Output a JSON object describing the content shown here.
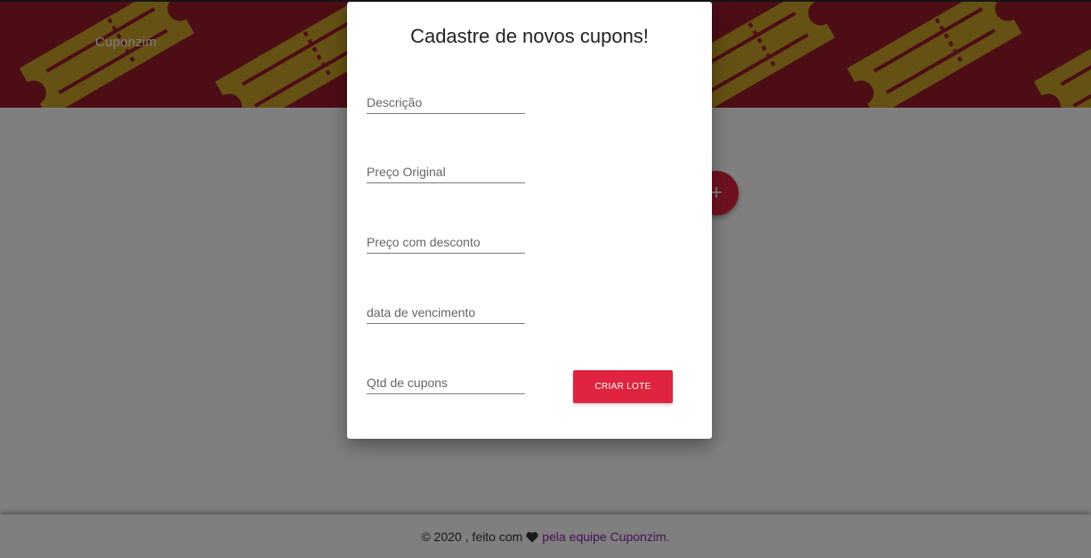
{
  "header": {
    "brand": "Cuponzim"
  },
  "fab": {
    "label": "+"
  },
  "modal": {
    "title": "Cadastre de novos cupons!",
    "fields": [
      {
        "placeholder": "Descrição"
      },
      {
        "placeholder": "Preço Original"
      },
      {
        "placeholder": "Preço com desconto"
      },
      {
        "placeholder": "data de vencimento"
      },
      {
        "placeholder": "Qtd de cupons"
      }
    ],
    "submit_label": "CRIAR LOTE"
  },
  "footer": {
    "prefix": "© 2020 , feito com",
    "link": "pela equipe Cuponzim."
  },
  "colors": {
    "header": "#9b1b2b",
    "accent": "#e0243f",
    "ticket": "#c9a227",
    "link": "#8e24aa"
  }
}
